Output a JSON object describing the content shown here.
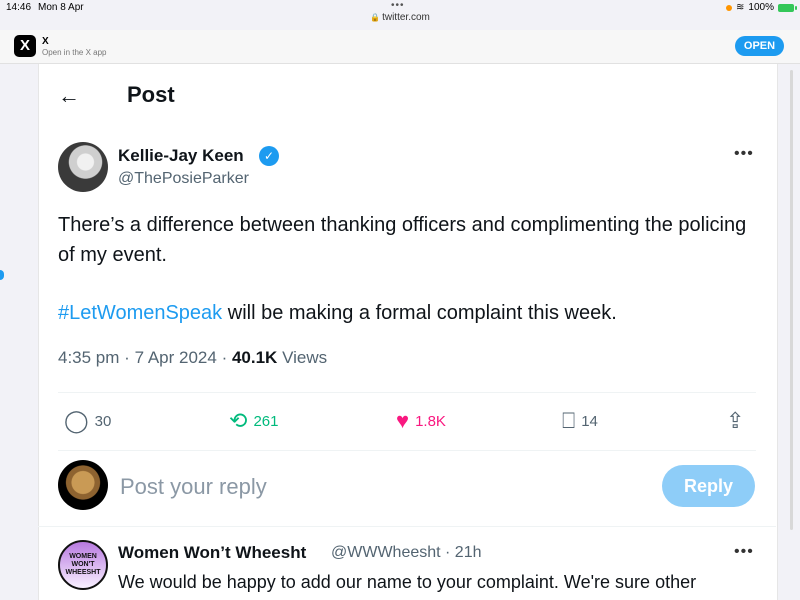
{
  "status": {
    "time": "14:46",
    "date": "Mon 8 Apr",
    "battery": "100%",
    "dots": "•••"
  },
  "browser": {
    "url": "twitter.com"
  },
  "app_banner": {
    "logo": "X",
    "name": "X",
    "subtitle": "Open in the X app",
    "open_label": "OPEN"
  },
  "header": {
    "back_label": "←",
    "title": "Post"
  },
  "tweet": {
    "author_name": "Kellie-Jay Keen",
    "handle": "@ThePosieParker",
    "more": "•••",
    "text_line1": "There’s a difference between thanking officers and complimenting the policing of my event.",
    "hashtag": "#LetWomenSpeak",
    "text_line2_rest": " will be making a formal complaint this week.",
    "time": "4:35 pm",
    "date": "7 Apr 2024",
    "views_count": "40.1K",
    "views_label": "Views",
    "sep": "·"
  },
  "actions": {
    "replies": "30",
    "reposts": "261",
    "likes": "1.8K",
    "bookmarks": "14"
  },
  "reply_box": {
    "placeholder": "Post your reply",
    "button": "Reply"
  },
  "reply": {
    "author_name": "Women Won’t Wheesht",
    "handle": "@WWWheesht · 21h",
    "avatar_text": "WOMEN WON'T WHEESHT",
    "more": "•••",
    "text": "We would be happy to add our name to your complaint. We're sure other"
  },
  "colors": {
    "accent": "#1d9bf0",
    "repost": "#00ba7c",
    "like": "#f91880"
  }
}
